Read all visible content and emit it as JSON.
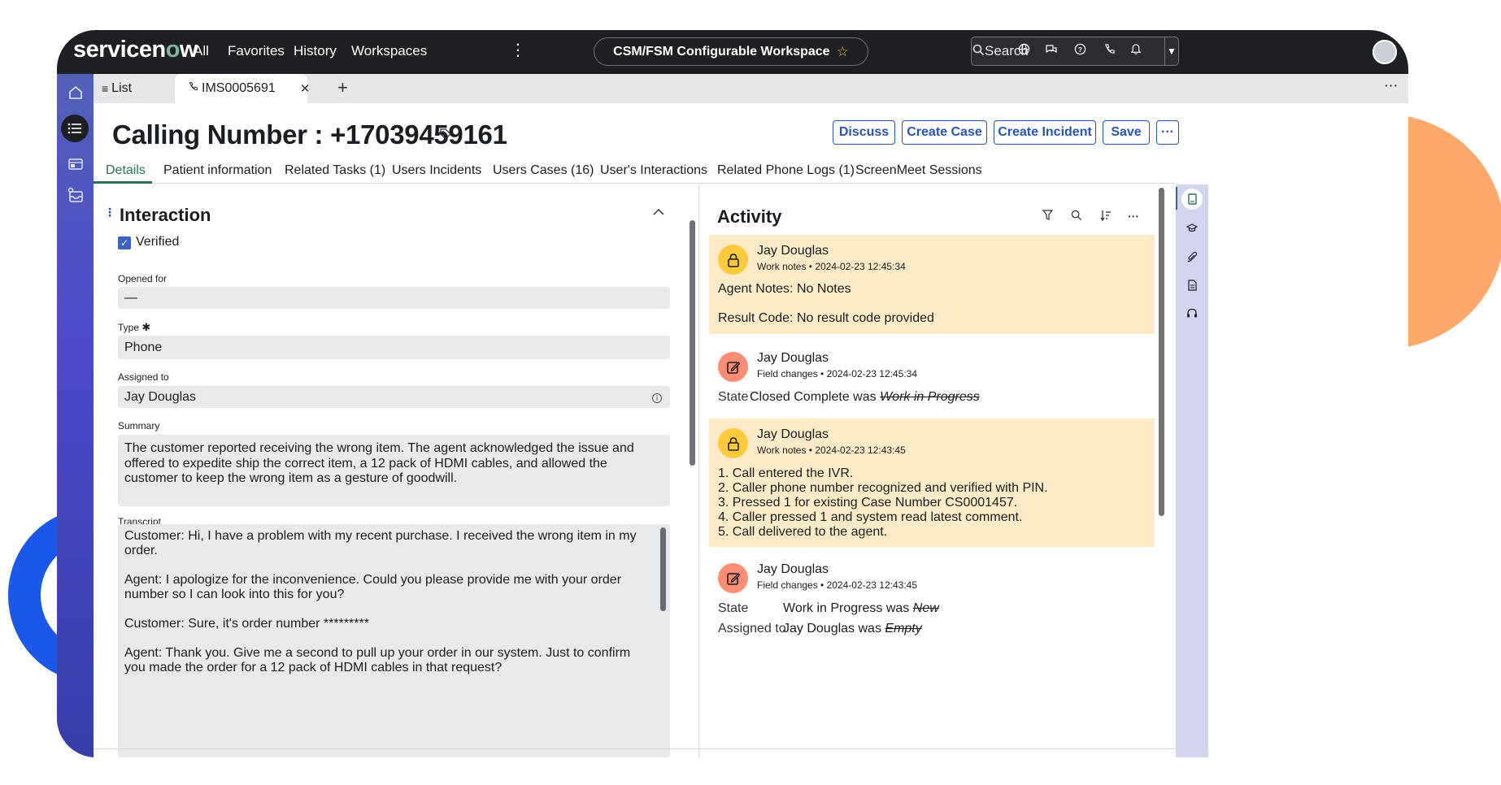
{
  "topbar": {
    "logo": "servicenow",
    "nav": [
      "All",
      "Favorites",
      "History",
      "Workspaces"
    ],
    "workspace_title": "CSM/FSM Configurable Workspace",
    "search_placeholder": "Search"
  },
  "tabs": {
    "list_label": "List",
    "record_label": "IMS0005691"
  },
  "record": {
    "title": "Calling Number : +17039459161",
    "buttons": {
      "discuss": "Discuss",
      "create_case": "Create Case",
      "create_incident": "Create Incident",
      "save": "Save"
    },
    "subtabs": [
      "Details",
      "Patient information",
      "Related Tasks (1)",
      "Users Incidents",
      "Users Cases (16)",
      "User's Interactions",
      "Related Phone Logs (1)",
      "ScreenMeet Sessions"
    ]
  },
  "form": {
    "section_title": "Interaction",
    "verified_label": "Verified",
    "opened_for_label": "Opened for",
    "opened_for_value": "—",
    "type_label": "Type",
    "type_required": "✱",
    "type_value": "Phone",
    "assigned_to_label": "Assigned to",
    "assigned_to_value": "Jay Douglas",
    "summary_label": "Summary",
    "summary_value": "The customer reported receiving the wrong item. The agent acknowledged the issue and offered to expedite ship the correct item, a 12 pack of HDMI cables, and allowed the customer to keep the wrong item as a gesture of goodwill.",
    "transcript_label": "Transcript",
    "transcript_lines": [
      "Customer: Hi, I have a problem with my recent purchase. I received the wrong item in my order.",
      "Agent: I apologize for the inconvenience. Could you please provide me with your order number so I can look into this for you?",
      "Customer: Sure, it's order number *********",
      "Agent: Thank you. Give me a second to pull up your order in our system. Just to confirm you made the order for a 12 pack of HDMI cables in that request?"
    ]
  },
  "activity": {
    "title": "Activity",
    "entries": [
      {
        "author": "Jay Douglas",
        "meta": "Work notes • 2024-02-23 12:45:34",
        "line1": "Agent Notes: No Notes",
        "line2": "Result Code: No result code provided"
      },
      {
        "author": "Jay Douglas",
        "meta": "Field changes • 2024-02-23 12:45:34",
        "field": "State",
        "new_value": "Closed Complete was",
        "old_value": "Work in Progress"
      },
      {
        "author": "Jay Douglas",
        "meta": "Work notes • 2024-02-23 12:43:45",
        "lines": [
          "1. Call entered the IVR.",
          "2. Caller phone number recognized and verified with PIN.",
          "3. Pressed 1 for existing Case Number CS0001457.",
          "4. Caller pressed 1 and system read latest comment.",
          "5. Call delivered to the agent."
        ]
      },
      {
        "author": "Jay Douglas",
        "meta": "Field changes • 2024-02-23 12:43:45",
        "field1": "State",
        "value1": "Work in Progress was",
        "old1": "New",
        "field2": "Assigned to",
        "value2": "Jay Douglas was",
        "old2": "Empty"
      }
    ]
  },
  "colors": {
    "accent": "#2953b5",
    "topbar": "#1e1f23",
    "work_note_bg": "#fdebc8",
    "active_tab": "#2b6e59"
  }
}
